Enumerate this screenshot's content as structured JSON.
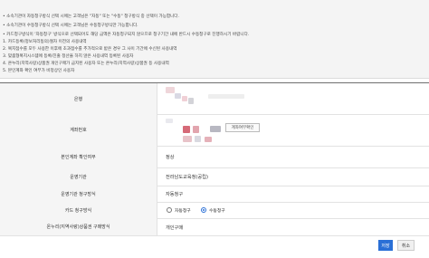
{
  "notice": {
    "lines": [
      "• 소속기관이 자동청구방식 선택 시에는 고객님은 \"자동\" 또는 \"수동\" 청구방식 중 선택이 가능합니다.",
      "• 소속기관이 수동청구방식 선택 시에는 고객님은 수동청구방식만 가능합니다.",
      "• 카드청구방식이 '자동청구' 방식으로 선택되어도 해당 금액은 자동청구되지 않으므로 청구기간 내에 반드시 수동청구로 진행하시기 바랍니다.",
      "1. 카드등록(정보처리동의)절차 이전의 사용내역",
      "2. 복지점수를 모두 사용한 이후에 초과점수를 추가적으로 받은 경우 그 사이 기간에 수신된 사용내역",
      "3. 맞춤형복지시스템에 등록/진출 정산을 하지 않은 사용내역 등록된 사용자",
      "4. 온누리(지역사랑)상품권 개인구매가 금지된 사용자 또는 온누리(지역사랑)상품권 등 사용내역",
      "5. 본인계좌 확인 여부가 비정상인 사용자"
    ]
  },
  "form": {
    "labels": {
      "bank": "은행",
      "account": "계좌번호",
      "self_check": "본인계좌 확인여부",
      "org": "운영기관",
      "org_method": "운영기관 청구방식",
      "card_method": "카드 청구방식",
      "onnuri": "온누리(지역사랑)상품권 구매방식"
    },
    "values": {
      "account_check_button": "계좌여부확인",
      "self_check": "정상",
      "org": "전라남도교육청(공립)",
      "org_method": "자동청구",
      "card_method_options": [
        "자동청구",
        "수동청구"
      ],
      "card_method_selected": "수동청구",
      "onnuri": "개인구매"
    }
  },
  "buttons": {
    "save": "저장",
    "cancel": "취소"
  },
  "colors": {
    "accent": "#2a6fd6",
    "label_bg": "#f5f5f5"
  }
}
